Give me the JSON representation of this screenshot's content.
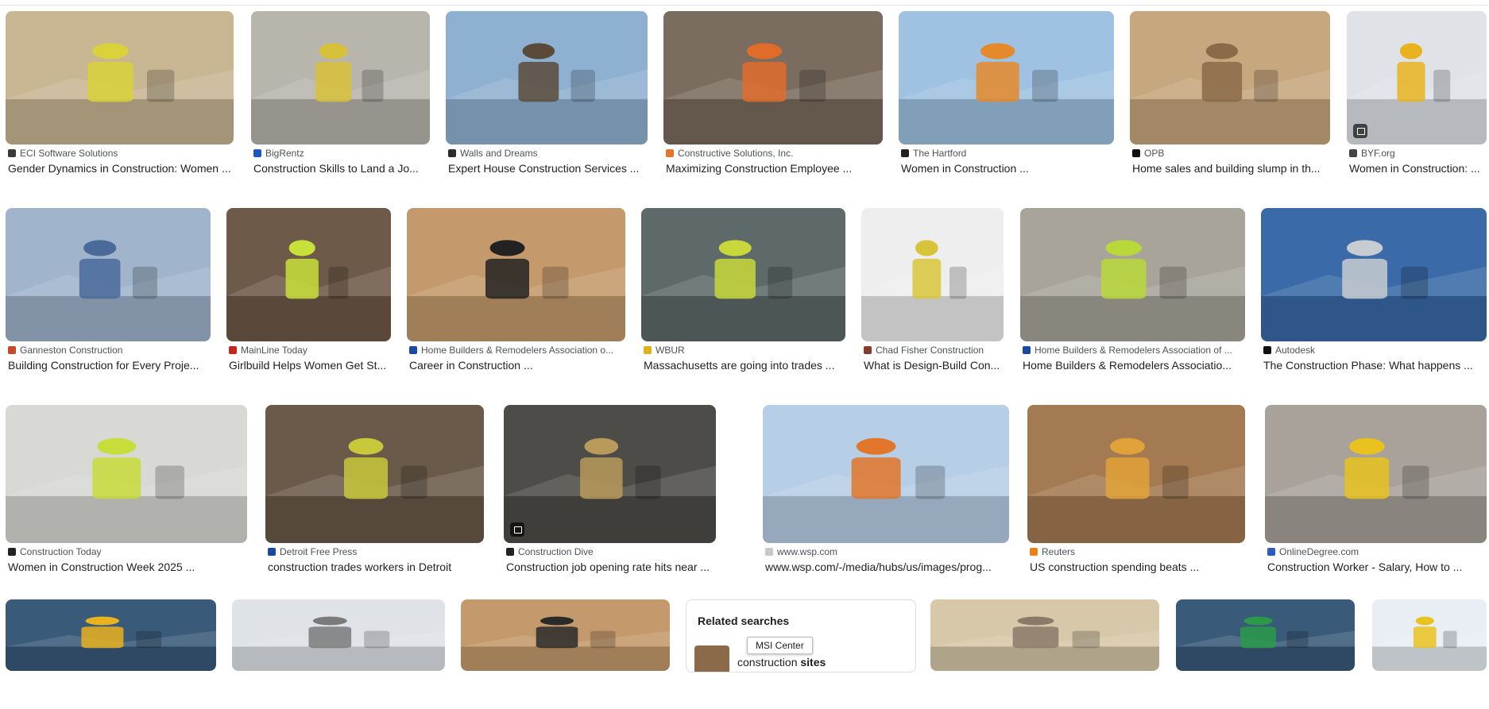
{
  "results": [
    {
      "source": "ECI Software Solutions",
      "title": "Gender Dynamics in Construction: Women ...",
      "fav": "#3a3a3a",
      "bg": "#c9b693",
      "fg": "#d9d23a",
      "badge": false
    },
    {
      "source": "BigRentz",
      "title": "Construction Skills to Land a Jo...",
      "fav": "#1a56c4",
      "bg": "#b8b5ad",
      "fg": "#d8c13a",
      "badge": false
    },
    {
      "source": "Walls and Dreams",
      "title": "Expert House Construction Services ...",
      "fav": "#2b2b2b",
      "bg": "#8fb1d1",
      "fg": "#5a4a3a",
      "badge": false
    },
    {
      "source": "Constructive Solutions, Inc.",
      "title": "Maximizing Construction Employee ...",
      "fav": "#e0762a",
      "bg": "#7a6c5e",
      "fg": "#e06c2a",
      "badge": false
    },
    {
      "source": "The Hartford",
      "title": "Women in Construction ...",
      "fav": "#222222",
      "bg": "#9fc2e2",
      "fg": "#e58a2a",
      "badge": false
    },
    {
      "source": "OPB",
      "title": "Home sales and building slump in th...",
      "fav": "#111111",
      "bg": "#c7a77e",
      "fg": "#8a6a48",
      "badge": false
    },
    {
      "source": "BYF.org",
      "title": "Women in Construction: ...",
      "fav": "#444444",
      "bg": "#dfe3e8",
      "fg": "#e9b21f",
      "badge": true
    },
    {
      "source": "Ganneston Construction",
      "title": "Building Construction for Every Proje...",
      "fav": "#c44a2a",
      "bg": "#a0b4cc",
      "fg": "#4a6a9a",
      "badge": false
    },
    {
      "source": "MainLine Today",
      "title": "Girlbuild Helps Women Get St...",
      "fav": "#c4261d",
      "bg": "#6e5a48",
      "fg": "#c8e03a",
      "badge": false
    },
    {
      "source": "Home Builders & Remodelers Association o...",
      "title": "Career in Construction ...",
      "fav": "#1a4aa0",
      "bg": "#c49a6c",
      "fg": "#222222",
      "badge": false
    },
    {
      "source": "WBUR",
      "title": "Massachusetts are going into trades ...",
      "fav": "#e0b21a",
      "bg": "#5e6a6a",
      "fg": "#c8d83a",
      "badge": false
    },
    {
      "source": "Chad Fisher Construction",
      "title": "What is Design-Build Con...",
      "fav": "#8a3a2a",
      "bg": "#eeeeee",
      "fg": "#d8c43a",
      "badge": false
    },
    {
      "source": "Home Builders & Remodelers Association of ...",
      "title": "Home Builders & Remodelers Associatio...",
      "fav": "#1a4aa0",
      "bg": "#a8a49a",
      "fg": "#b9d83a",
      "badge": false
    },
    {
      "source": "Autodesk",
      "title": "The Construction Phase: What happens ...",
      "fav": "#111111",
      "bg": "#3a6aa8",
      "fg": "#c8ccd0",
      "badge": false
    },
    {
      "source": "Construction Today",
      "title": "Women in Construction Week 2025 ...",
      "fav": "#222222",
      "bg": "#d8d8d4",
      "fg": "#c8dc3a",
      "badge": false
    },
    {
      "source": "Detroit Free Press",
      "title": "construction trades workers in Detroit",
      "fav": "#1a4aa0",
      "bg": "#6a5a4a",
      "fg": "#c8c83a",
      "badge": false
    },
    {
      "source": "Construction Dive",
      "title": "Construction job opening rate hits near ...",
      "fav": "#222222",
      "bg": "#4e4c48",
      "fg": "#b89a5a",
      "badge": true
    },
    {
      "source": "www.wsp.com",
      "title": "www.wsp.com/-/media/hubs/us/images/prog...",
      "fav": "#c8c8c8",
      "bg": "#b7cfe6",
      "fg": "#e2762a",
      "badge": false
    },
    {
      "source": "Reuters",
      "title": "US construction spending beats ...",
      "fav": "#e8821a",
      "bg": "#a47a52",
      "fg": "#e2a23a",
      "badge": false
    },
    {
      "source": "OnlineDegree.com",
      "title": "Construction Worker - Salary, How to ...",
      "fav": "#2a5ac4",
      "bg": "#a8a29a",
      "fg": "#e9c21f",
      "badge": false
    },
    {
      "bg": "#3a5a7a",
      "fg": "#e9b21f"
    },
    {
      "bg": "#dfe3e8",
      "fg": "#7a7a7a"
    },
    {
      "bg": "#c49a6c",
      "fg": "#2a2a2a"
    },
    {
      "bg": "#d6c8a8",
      "fg": "#8a7a6a"
    },
    {
      "bg": "#3a5a7a",
      "fg": "#2a9a4a"
    },
    {
      "bg": "#e8eef4",
      "fg": "#e9c21f"
    }
  ],
  "related": {
    "heading": "Related searches",
    "query_prefix": "construction ",
    "query_bold": "sites"
  },
  "tooltip": "MSI Center"
}
